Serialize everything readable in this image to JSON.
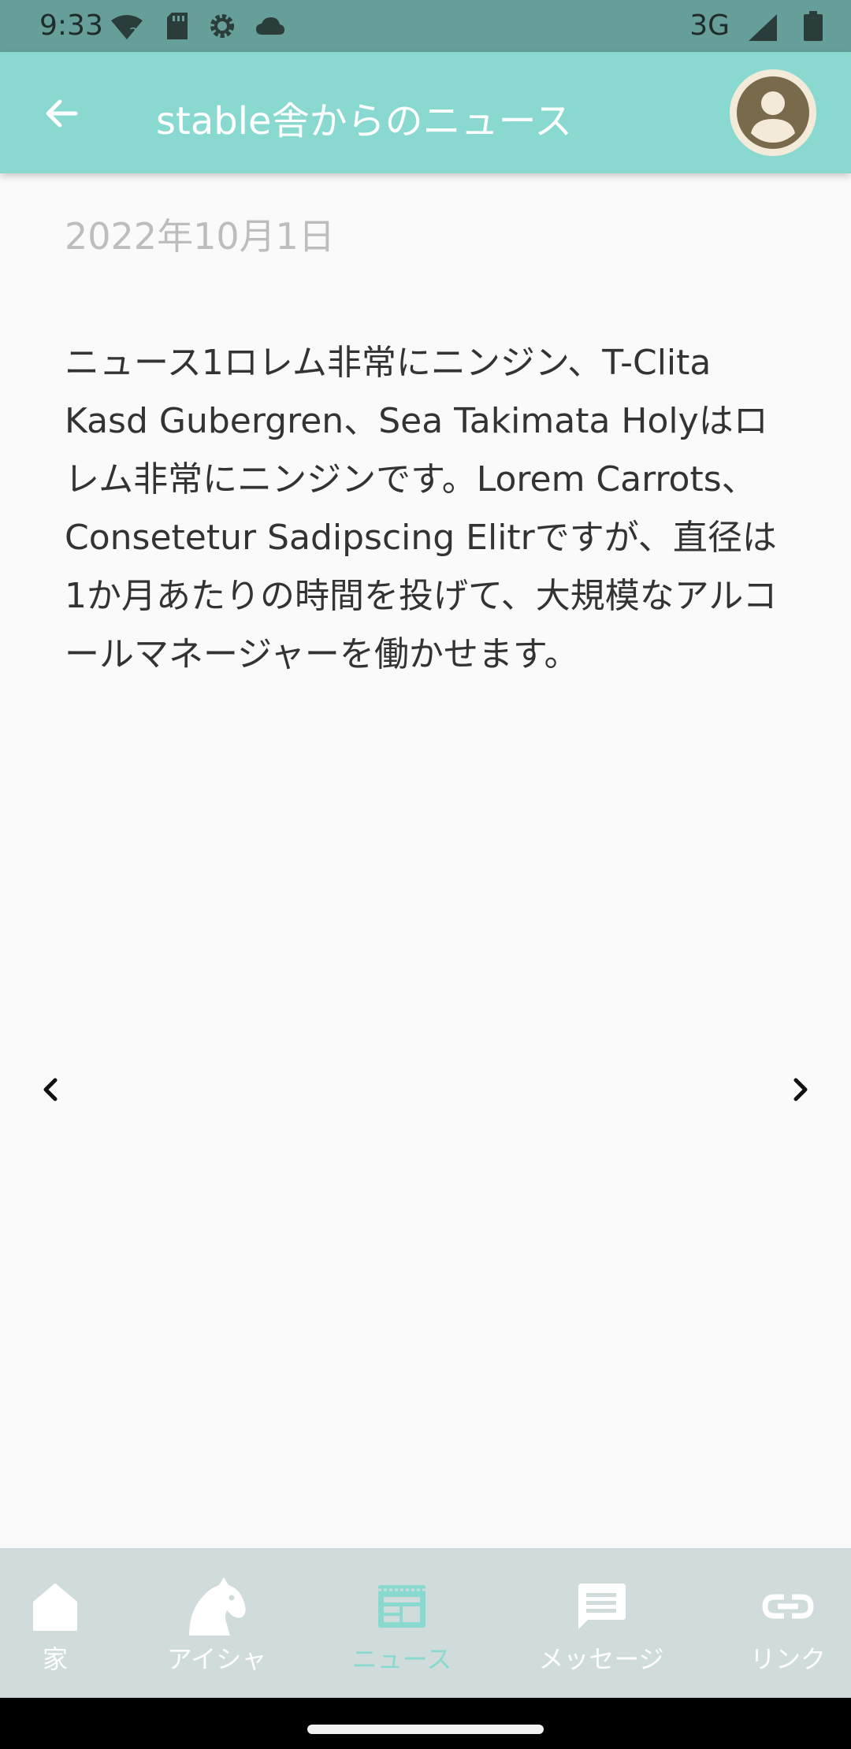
{
  "status_bar": {
    "time": "9:33",
    "network": "3G"
  },
  "app_bar": {
    "title": "stable舎からのニュース"
  },
  "news": {
    "date": "2022年10月1日",
    "body": "ニュース1ロレム非常にニンジン、T-Clita Kasd Gubergren、Sea Takimata Holyはロレム非常にニンジンです。Lorem Carrots、Consetetur Sadipscing Elitrですが、直径は1か月あたりの時間を投げて、大規模なアルコールマネージャーを働かせます。"
  },
  "bottom_nav": {
    "items": [
      {
        "label": "家",
        "icon": "home-icon"
      },
      {
        "label": "アイシャ",
        "icon": "horse-icon"
      },
      {
        "label": "ニュース",
        "icon": "news-icon",
        "active": true
      },
      {
        "label": "メッセージ",
        "icon": "message-icon"
      },
      {
        "label": "リンク",
        "icon": "link-icon"
      }
    ]
  },
  "colors": {
    "status_bar": "#669e99",
    "app_bar": "#8ad9d1",
    "bottom_nav": "#cfdcdb",
    "active": "#8ad9d1"
  }
}
